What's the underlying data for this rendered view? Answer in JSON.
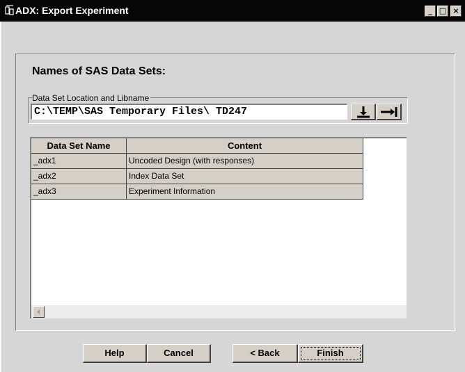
{
  "window": {
    "title": "ADX: Export Experiment",
    "controls": {
      "minimize": "_",
      "maximize": "□",
      "close": "×"
    }
  },
  "main": {
    "section_title": "Names of SAS Data Sets:",
    "location_group_label": "Data Set Location and Libname",
    "location_value": "C:\\TEMP\\SAS Temporary Files\\ TD247",
    "tools": [
      {
        "icon": "download-arrow-icon"
      },
      {
        "icon": "arrow-right-to-bar-icon"
      }
    ]
  },
  "table": {
    "columns": [
      "Data Set Name",
      "Content"
    ],
    "rows": [
      [
        "_adx1",
        "Uncoded Design (with responses)"
      ],
      [
        "_adx2",
        "Index Data Set"
      ],
      [
        "_adx3",
        "Experiment Information"
      ]
    ]
  },
  "buttons": {
    "help": "Help",
    "cancel": "Cancel",
    "back": "< Back",
    "finish": "Finish"
  }
}
